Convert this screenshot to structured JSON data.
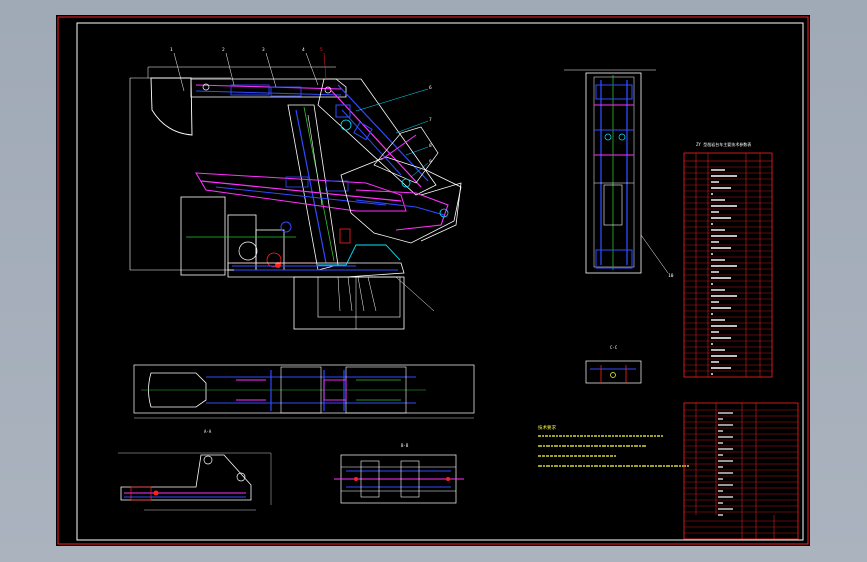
{
  "viewport": {
    "background": "#a3acb8",
    "sheet_color": "#000000",
    "frame_color": "#ffffff",
    "accent_colors": {
      "red": "#ff2020",
      "white": "#ffffff",
      "blue": "#2f4bff",
      "cyan": "#00e5ff",
      "magenta": "#ff30ff",
      "green": "#30c030",
      "yellow": "#ffff40"
    }
  },
  "drawing": {
    "views": [
      "main-side-view",
      "end-view",
      "plan-view",
      "lower-detail-left",
      "lower-detail-center",
      "small-detail"
    ],
    "notes_title": "技术要求",
    "detail_label_a": "A-A",
    "detail_label_b": "B-B",
    "detail_label_c": "C-C"
  }
}
